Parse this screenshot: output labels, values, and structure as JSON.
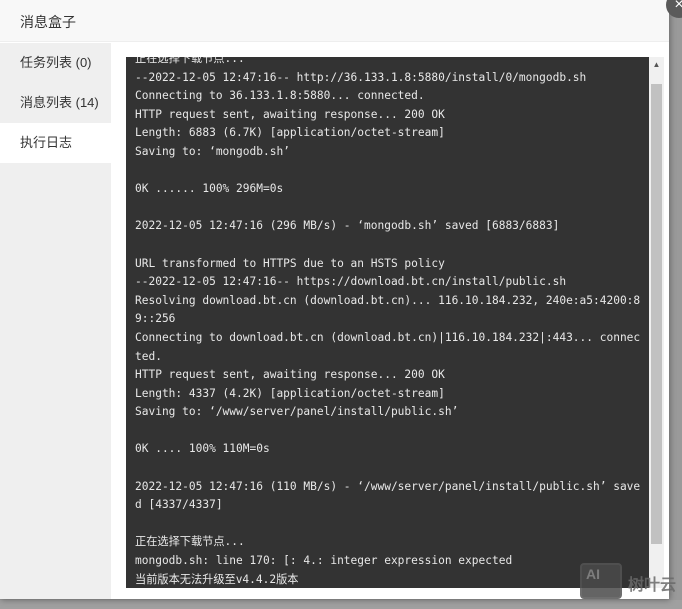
{
  "dialog": {
    "title": "消息盒子",
    "close_icon": "×"
  },
  "sidebar": {
    "items": [
      {
        "label": "任务列表 (0)",
        "active": false
      },
      {
        "label": "消息列表 (14)",
        "active": false
      },
      {
        "label": "执行日志",
        "active": true
      }
    ]
  },
  "log": {
    "lines": [
      "正在选择下载节点...",
      "--2022-12-05 12:47:16-- http://36.133.1.8:5880/install/0/mongodb.sh",
      "Connecting to 36.133.1.8:5880... connected.",
      "HTTP request sent, awaiting response... 200 OK",
      "Length: 6883 (6.7K) [application/octet-stream]",
      "Saving to: ‘mongodb.sh’",
      "",
      "0K ...... 100% 296M=0s",
      "",
      "2022-12-05 12:47:16 (296 MB/s) - ‘mongodb.sh’ saved [6883/6883]",
      "",
      "URL transformed to HTTPS due to an HSTS policy",
      "--2022-12-05 12:47:16-- https://download.bt.cn/install/public.sh",
      "Resolving download.bt.cn (download.bt.cn)... 116.10.184.232, 240e:a5:4200:89::256",
      "Connecting to download.bt.cn (download.bt.cn)|116.10.184.232|:443... connected.",
      "HTTP request sent, awaiting response... 200 OK",
      "Length: 4337 (4.2K) [application/octet-stream]",
      "Saving to: ‘/www/server/panel/install/public.sh’",
      "",
      "0K .... 100% 110M=0s",
      "",
      "2022-12-05 12:47:16 (110 MB/s) - ‘/www/server/panel/install/public.sh’ saved [4337/4337]",
      "",
      "正在选择下载节点...",
      "mongodb.sh: line 170: [: 4.: integer expression expected",
      "当前版本无法升级至v4.4.2版本"
    ]
  },
  "scrollbar": {
    "up_icon": "▲"
  },
  "watermark": {
    "icon_text": "AI",
    "label": "树叶云"
  }
}
